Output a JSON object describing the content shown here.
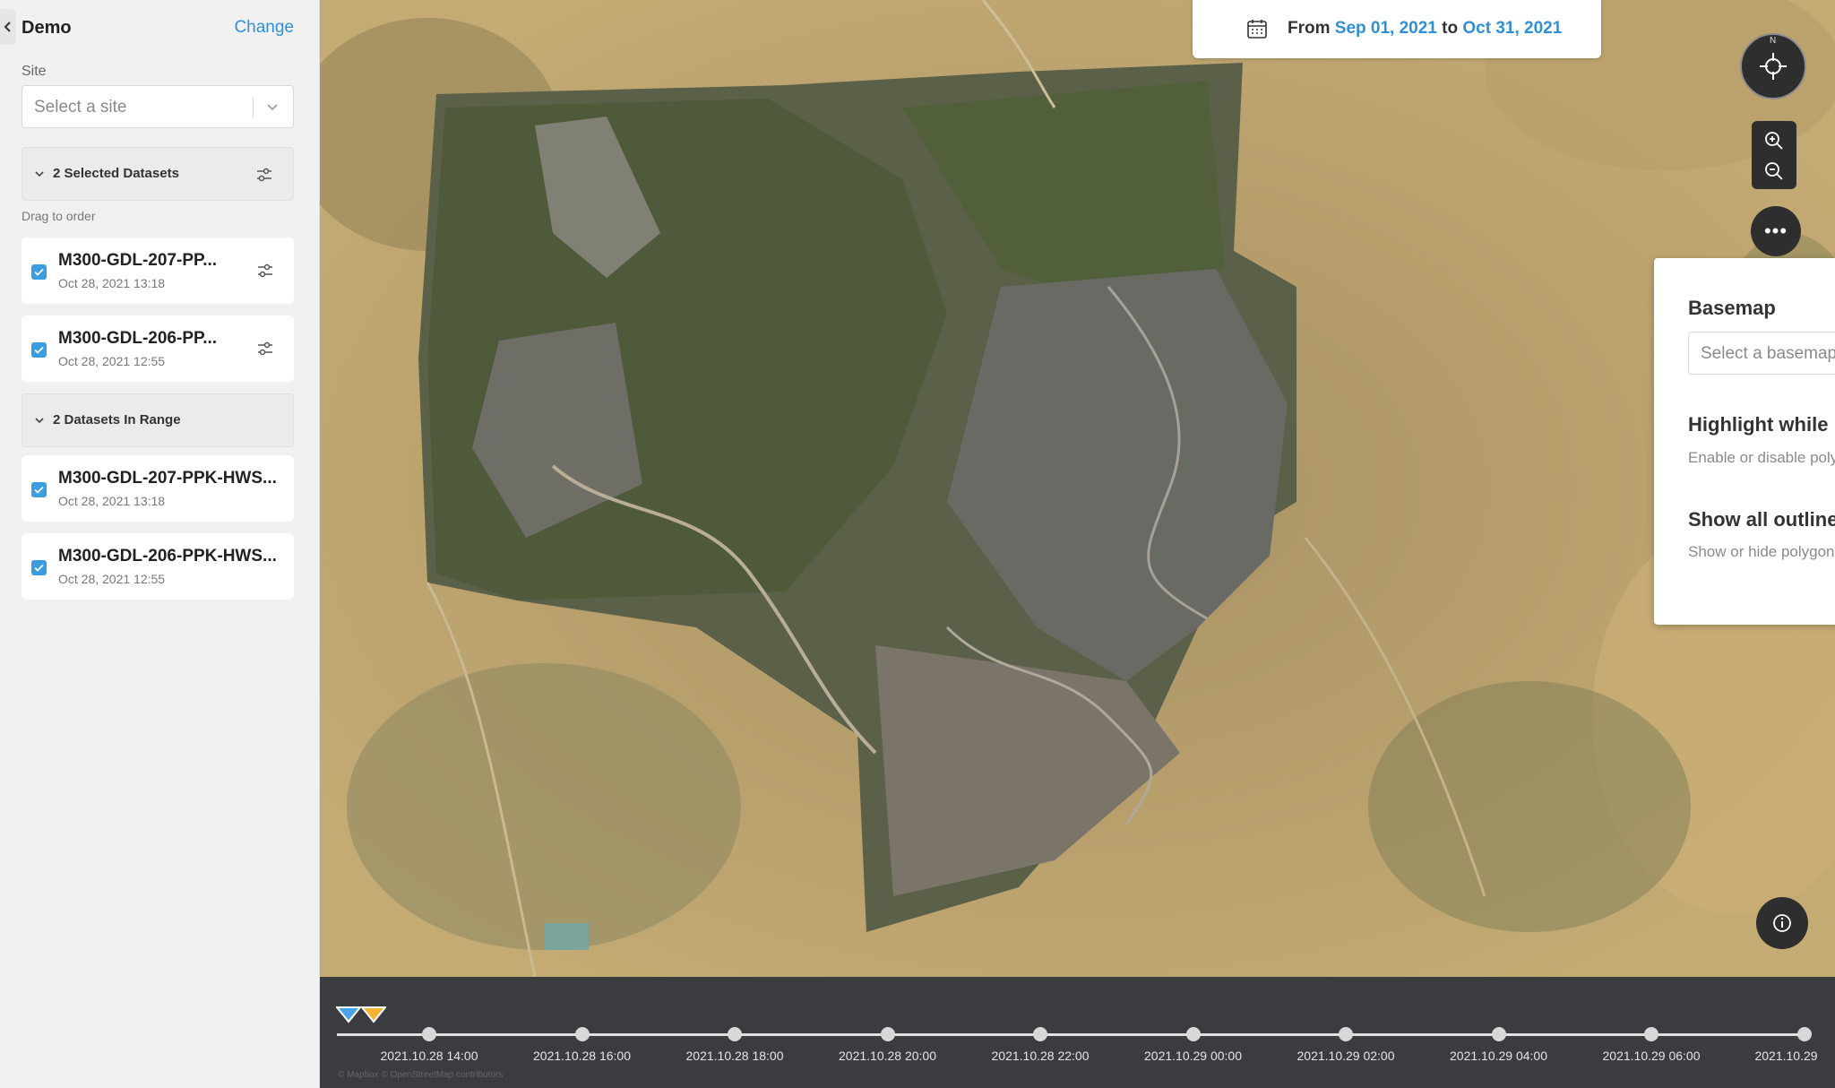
{
  "sidebar": {
    "title": "Demo",
    "change_label": "Change",
    "site_label": "Site",
    "site_placeholder": "Select a site",
    "selected_header": "2 Selected Datasets",
    "drag_hint": "Drag to order",
    "selected": [
      {
        "name": "M300-GDL-207-PP...",
        "date": "Oct 28, 2021 13:18"
      },
      {
        "name": "M300-GDL-206-PP...",
        "date": "Oct 28, 2021 12:55"
      }
    ],
    "range_header": "2 Datasets In Range",
    "in_range": [
      {
        "name": "M300-GDL-207-PPK-HWS...",
        "date": "Oct 28, 2021 13:18"
      },
      {
        "name": "M300-GDL-206-PPK-HWS...",
        "date": "Oct 28, 2021 12:55"
      }
    ]
  },
  "date_range": {
    "from_label": "From",
    "from": "Sep 01, 2021",
    "to_label": "to",
    "to": "Oct 31, 2021"
  },
  "controls": {
    "compass_letter": "N",
    "more_label": "•••"
  },
  "settings": {
    "basemap_title": "Basemap",
    "basemap_placeholder": "Select a basemap",
    "highlight_title": "Highlight while hovering",
    "highlight_desc": "Enable or disable polygon highlighting",
    "highlight_on": true,
    "outlines_title": "Show all outlines",
    "outlines_desc": "Show or hide polygon fill and outlines on the map",
    "outlines_on": false
  },
  "timeline": {
    "ticks": [
      "2021.10.28 14:00",
      "2021.10.28 16:00",
      "2021.10.28 18:00",
      "2021.10.28 20:00",
      "2021.10.28 22:00",
      "2021.10.29 00:00",
      "2021.10.29 02:00",
      "2021.10.29 04:00",
      "2021.10.29 06:00",
      "2021.10.29"
    ],
    "marker_colors": [
      "#4aa3e8",
      "#f2b233"
    ],
    "attribution": "© Mapbox © OpenStreetMap contributors"
  },
  "colors": {
    "accent": "#2f8fd8",
    "toggle_on": "#4caf50",
    "checkbox": "#3b9de0"
  }
}
